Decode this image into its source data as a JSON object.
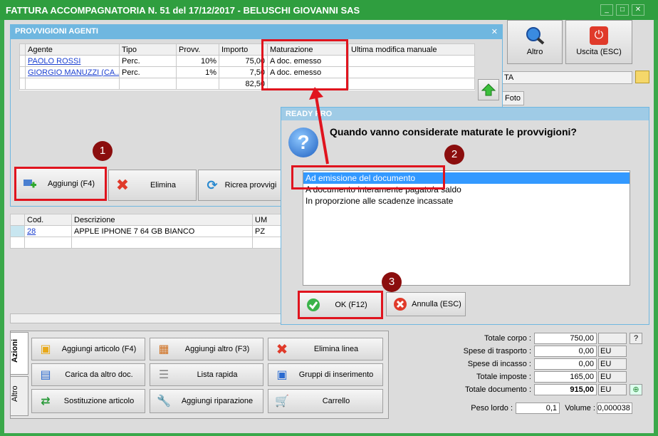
{
  "window": {
    "title": "FATTURA ACCOMPAGNATORIA N. 51 del 17/12/2017 - BELUSCHI GIOVANNI SAS",
    "minimize": "_",
    "maximize": "□",
    "close": "✕"
  },
  "toolbar": {
    "altro_label": "Altro",
    "uscita_label": "Uscita (ESC)"
  },
  "background": {
    "field_text": "TA",
    "tab_foto": "Foto"
  },
  "agents_dialog": {
    "title": "PROVVIGIONI AGENTI",
    "close": "✕",
    "columns": [
      "Agente",
      "Tipo",
      "Provv.",
      "Importo",
      "Maturazione",
      "Ultima modifica manuale"
    ],
    "rows": [
      {
        "agente": "PAOLO ROSSI",
        "tipo": "Perc.",
        "provv": "10%",
        "importo": "75,00",
        "maturazione": "A doc. emesso",
        "ultima": ""
      },
      {
        "agente": "GIORGIO MANUZZI (CA...",
        "tipo": "Perc.",
        "provv": "1%",
        "importo": "7,50",
        "maturazione": "A doc. emesso",
        "ultima": ""
      }
    ],
    "total": "82,50",
    "buttons": {
      "aggiungi": "Aggiungi (F4)",
      "elimina": "Elimina",
      "ricrea": "Ricrea provvigi"
    }
  },
  "articles_grid": {
    "columns": [
      "Cod.",
      "Descrizione",
      "UM"
    ],
    "rows": [
      {
        "cod": "28",
        "descrizione": "APPLE IPHONE 7 64 GB BIANCO",
        "um": "PZ"
      }
    ]
  },
  "ready_dialog": {
    "title": "READY PRO",
    "question": "Quando vanno considerate maturate le provvigioni?",
    "options": [
      "Ad emissione del documento",
      "A documento interamente pagato/a saldo",
      "In proporzione alle scadenze incassate"
    ],
    "selected_option": "Ad emissione del documento",
    "ok_label": "OK (F12)",
    "cancel_label": "Annulla (ESC)"
  },
  "badges": [
    "1",
    "2",
    "3"
  ],
  "side_tabs": {
    "azioni": "Azioni",
    "altro": "Altro"
  },
  "actions": {
    "aggiungi_articolo": "Aggiungi articolo (F4)",
    "aggiungi_altro": "Aggiungi altro (F3)",
    "elimina_linea": "Elimina linea",
    "carica_altro_doc": "Carica da altro doc.",
    "lista_rapida": "Lista rapida",
    "gruppi_inserimento": "Gruppi di inserimento",
    "sostituzione_articolo": "Sostituzione articolo",
    "aggiungi_riparazione": "Aggiungi riparazione",
    "carrello": "Carrello"
  },
  "totals": {
    "totale_corpo_label": "Totale corpo :",
    "totale_corpo": "750,00",
    "spese_trasporto_label": "Spese di trasporto :",
    "spese_trasporto": "0,00",
    "spese_incasso_label": "Spese di incasso :",
    "spese_incasso": "0,00",
    "totale_imposte_label": "Totale imposte :",
    "totale_imposte": "165,00",
    "totale_documento_label": "Totale documento :",
    "totale_documento": "915,00",
    "currency": "EU",
    "help": "?",
    "peso_lordo_label": "Peso lordo :",
    "peso_lordo": "0,1",
    "volume_label": "Volume :",
    "volume": "0,000038"
  },
  "colors": {
    "title_green": "#2f9e3f",
    "dialog_blue": "#6fb7e0",
    "highlight_red": "#e0141e",
    "badge_red": "#8b0e0e",
    "selection_blue": "#3399ff"
  }
}
